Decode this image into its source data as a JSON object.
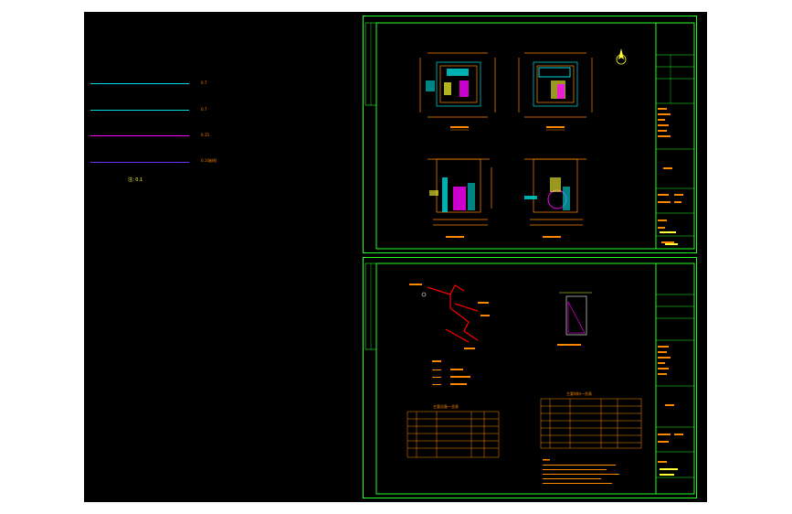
{
  "legend": {
    "items": [
      {
        "label": "0.7",
        "color": "#00dddd"
      },
      {
        "label": "0.7",
        "color": "#00dddd"
      },
      {
        "label": "0.15",
        "color": "#ff00ff"
      },
      {
        "label": "0.1(暗线)",
        "color": "#6633ff"
      }
    ],
    "note": "注: 0.1"
  },
  "sheets": [
    {
      "title": "建筑平面图"
    },
    {
      "title": "系统示意图"
    }
  ],
  "colors": {
    "background": "#000000",
    "frame": "#22ff22",
    "text": "#ff8800",
    "cyan": "#00dddd",
    "magenta": "#ff00ff",
    "yellow": "#ffff33"
  }
}
